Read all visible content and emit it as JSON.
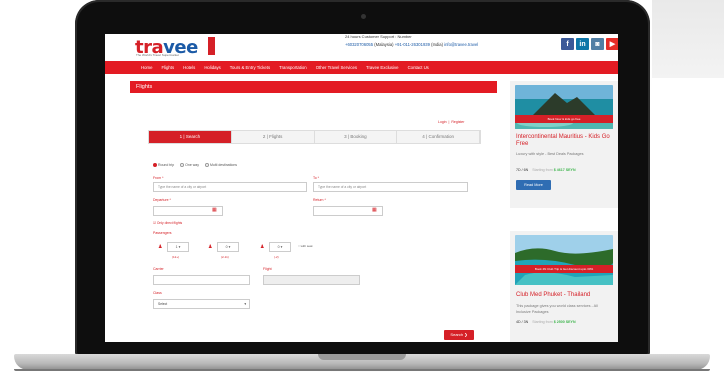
{
  "site": {
    "logo_text": "travee",
    "logo_badge": "trave",
    "tagline": "The World's Travel Supermarket",
    "support": "24 hours Customer Support : Number",
    "phone_my": "+60320706055",
    "phone_my_label": "(Malaysia)",
    "phone_in": "+91-011-26301939",
    "phone_in_label": "(India)",
    "email": "info@travee.travel"
  },
  "nav": {
    "items": [
      "Home",
      "Flights",
      "Hotels",
      "Holidays",
      "Tours & Entry Tickets",
      "Transportation",
      "Other Travel Services",
      "Travee Exclusive",
      "Contact Us"
    ]
  },
  "flights": {
    "heading": "Flights",
    "login": "Login",
    "register": "Register",
    "steps": [
      "1 | Search",
      "2 | Flights",
      "3 | Booking",
      "4 | Confirmation"
    ],
    "trip_types": [
      "Round trip",
      "One way",
      "Multi destinations"
    ],
    "from_label": "From *",
    "from_placeholder": "Type the name of a city or airport",
    "to_label": "To *",
    "to_placeholder": "Type the name of a city or airport",
    "departure_label": "Departure *",
    "return_label": "Return *",
    "direct_label": "Only direct flights",
    "passengers_label": "Passengers",
    "adult_value": "1",
    "adult_label": "(12+)",
    "child_value": "0",
    "child_label": "(2-11)",
    "infant_value": "0",
    "infant_label": "(-2)",
    "seat_label": "with seat",
    "carrier_label": "Carrier",
    "flight_label": "Flight",
    "class_label": "Class",
    "class_value": "Select",
    "search_button": "Search"
  },
  "deals": [
    {
      "ribbon": "Book Now & kids go free",
      "title": "Intercontinental Mauritius - Kids Go Free",
      "text": "Luxury with style - Best Deals Packages",
      "nights": "7D / 6N",
      "price_prefix": "Starting from",
      "price": "$ 4617 SEYN",
      "button": "Read More"
    },
    {
      "ribbon": "Book 4N Club Trip & Get discount upto 30%",
      "title": "Club Med Phuket - Thailand",
      "text": "This package gives you world class services - All Inclusive Packages",
      "nights": "4D / 3N",
      "price_prefix": "Starting from",
      "price": "$ 2500 SEYN"
    }
  ],
  "colors": {
    "brand_red": "#e31b23",
    "brand_blue": "#1b5aa6",
    "price_green": "#3cb44b"
  }
}
